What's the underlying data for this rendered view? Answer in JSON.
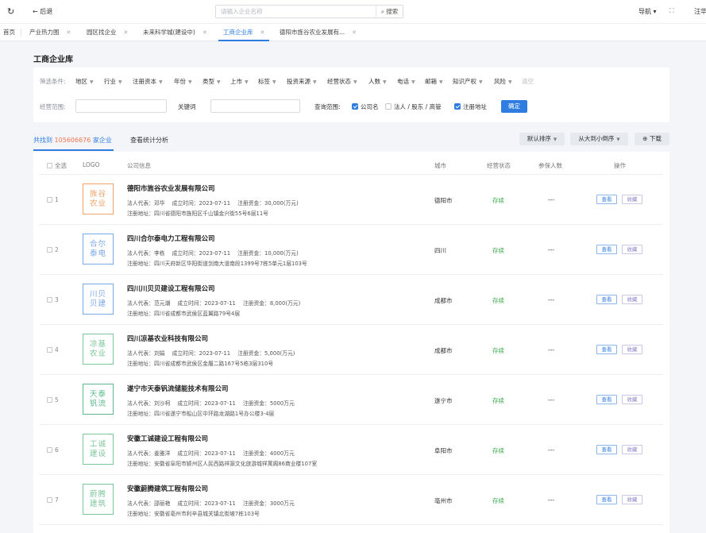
{
  "topbar": {
    "refresh_icon": "refresh-icon",
    "back_label": "← 后退",
    "search_placeholder": "请输入企业名称",
    "search_button": "⌕ 搜索",
    "nav_label": "导航 ▾",
    "fullscreen_icon": "⛶",
    "user": "汪华"
  },
  "tabs": [
    {
      "label": "首页"
    },
    {
      "label": "产业热力图"
    },
    {
      "label": "园区找企业"
    },
    {
      "label": "未来科学城(建设中)"
    },
    {
      "label": "工商企业库"
    },
    {
      "label": "德阳市旌谷农业发展有..."
    }
  ],
  "page_title": "工商企业库",
  "filters": {
    "label": "筛选条件:",
    "chips": [
      "地区",
      "行业",
      "注册资本",
      "年份",
      "类型",
      "上市",
      "标签",
      "投资来源",
      "经营状态",
      "人数",
      "电话",
      "邮箱",
      "知识产权",
      "风险"
    ],
    "clear": "清空",
    "scope_label": "经营范围:",
    "keyword_label": "关键词",
    "query_scope_label": "查询范围:",
    "options": [
      {
        "label": "公司名",
        "checked": true
      },
      {
        "label": "法人 / 股东 / 高管",
        "checked": false
      },
      {
        "label": "注册地址",
        "checked": true
      }
    ],
    "confirm": "确定"
  },
  "results": {
    "prefix": "共找到 ",
    "count": "105606676",
    "suffix": " 家企业",
    "stats_tab": "查看统计分析",
    "sort_default": "默认排序",
    "sort_order": "从大到小倒序",
    "download": "⊕ 下载"
  },
  "table": {
    "headers": {
      "select_all": "全选",
      "logo": "LOGO",
      "info": "公司信息",
      "city": "城市",
      "status": "经营状态",
      "insured": "参保人数",
      "ops": "操作"
    },
    "view_label": "查看",
    "fav_label": "收藏",
    "rows": [
      {
        "idx": "1",
        "logo": "旌谷农业",
        "logo_color": "#f0a36b",
        "name": "德阳市旌谷农业发展有限公司",
        "legal": "法人代表：邓华",
        "date": "成立时间：2023-07-11",
        "capital": "注册资金：30,000(万元)",
        "address": "注册地址：四川省德阳市旌阳区千山镇金兴街55号6层11号",
        "city": "德阳市",
        "status": "存续",
        "insured": "---"
      },
      {
        "idx": "2",
        "logo": "合尔泰电",
        "logo_color": "#7aa7e8",
        "name": "四川合尔泰电力工程有限公司",
        "legal": "法人代表：李栋",
        "date": "成立时间：2023-07-11",
        "capital": "注册资金：10,000(万元)",
        "address": "注册地址：四川天府新区华阳街道剑南大道南段1399号7栋5单元1层103号",
        "city": "四川",
        "status": "存续",
        "insured": "---"
      },
      {
        "idx": "3",
        "logo": "川贝贝建",
        "logo_color": "#7aa7e8",
        "name": "四川川贝贝建设工程有限公司",
        "legal": "法人代表：范元潮",
        "date": "成立时间：2023-07-11",
        "capital": "注册资金：8,000(万元)",
        "address": "注册地址：四川省成都市武侯区蓝翼路79号4层",
        "city": "成都市",
        "status": "存续",
        "insured": "---"
      },
      {
        "idx": "4",
        "logo": "凉基农业",
        "logo_color": "#7cc79a",
        "name": "四川凉基农业科技有限公司",
        "legal": "法人代表：刘娟",
        "date": "成立时间：2023-07-11",
        "capital": "注册资金：5,000(万元)",
        "address": "注册地址：四川省成都市武侯区金履二路167号5栋3层310号",
        "city": "成都市",
        "status": "存续",
        "insured": "---"
      },
      {
        "idx": "5",
        "logo": "天泰钒流",
        "logo_color": "#5cb98a",
        "name": "遂宁市天泰钒流储能技术有限公司",
        "legal": "法人代表：刘沙柯",
        "date": "成立时间：2023-07-11",
        "capital": "注册资金：5000万元",
        "address": "注册地址：四川省遂宁市船山区中环路龙湖路1号办公楼3-4层",
        "city": "遂宁市",
        "status": "存续",
        "insured": "---"
      },
      {
        "idx": "6",
        "logo": "工诚建设",
        "logo_color": "#7cc79a",
        "name": "安徽工诚建设工程有限公司",
        "legal": "法人代表：姜雅洋",
        "date": "成立时间：2023-07-11",
        "capital": "注册资金：4000万元",
        "address": "注册地址：安徽省阜阳市颍州区人民西路祥源文化旅游城祥寓阁86商业楼107室",
        "city": "阜阳市",
        "status": "存续",
        "insured": "---"
      },
      {
        "idx": "7",
        "logo": "蔚腾建筑",
        "logo_color": "#7cc79a",
        "name": "安徽蔚腾建筑工程有限公司",
        "legal": "法人代表：邵丽艳",
        "date": "成立时间：2023-07-11",
        "capital": "注册资金：3000万元",
        "address": "注册地址：安徽省亳州市利辛县城关镇北街坡7栋103号",
        "city": "亳州市",
        "status": "存续",
        "insured": "---"
      }
    ]
  }
}
